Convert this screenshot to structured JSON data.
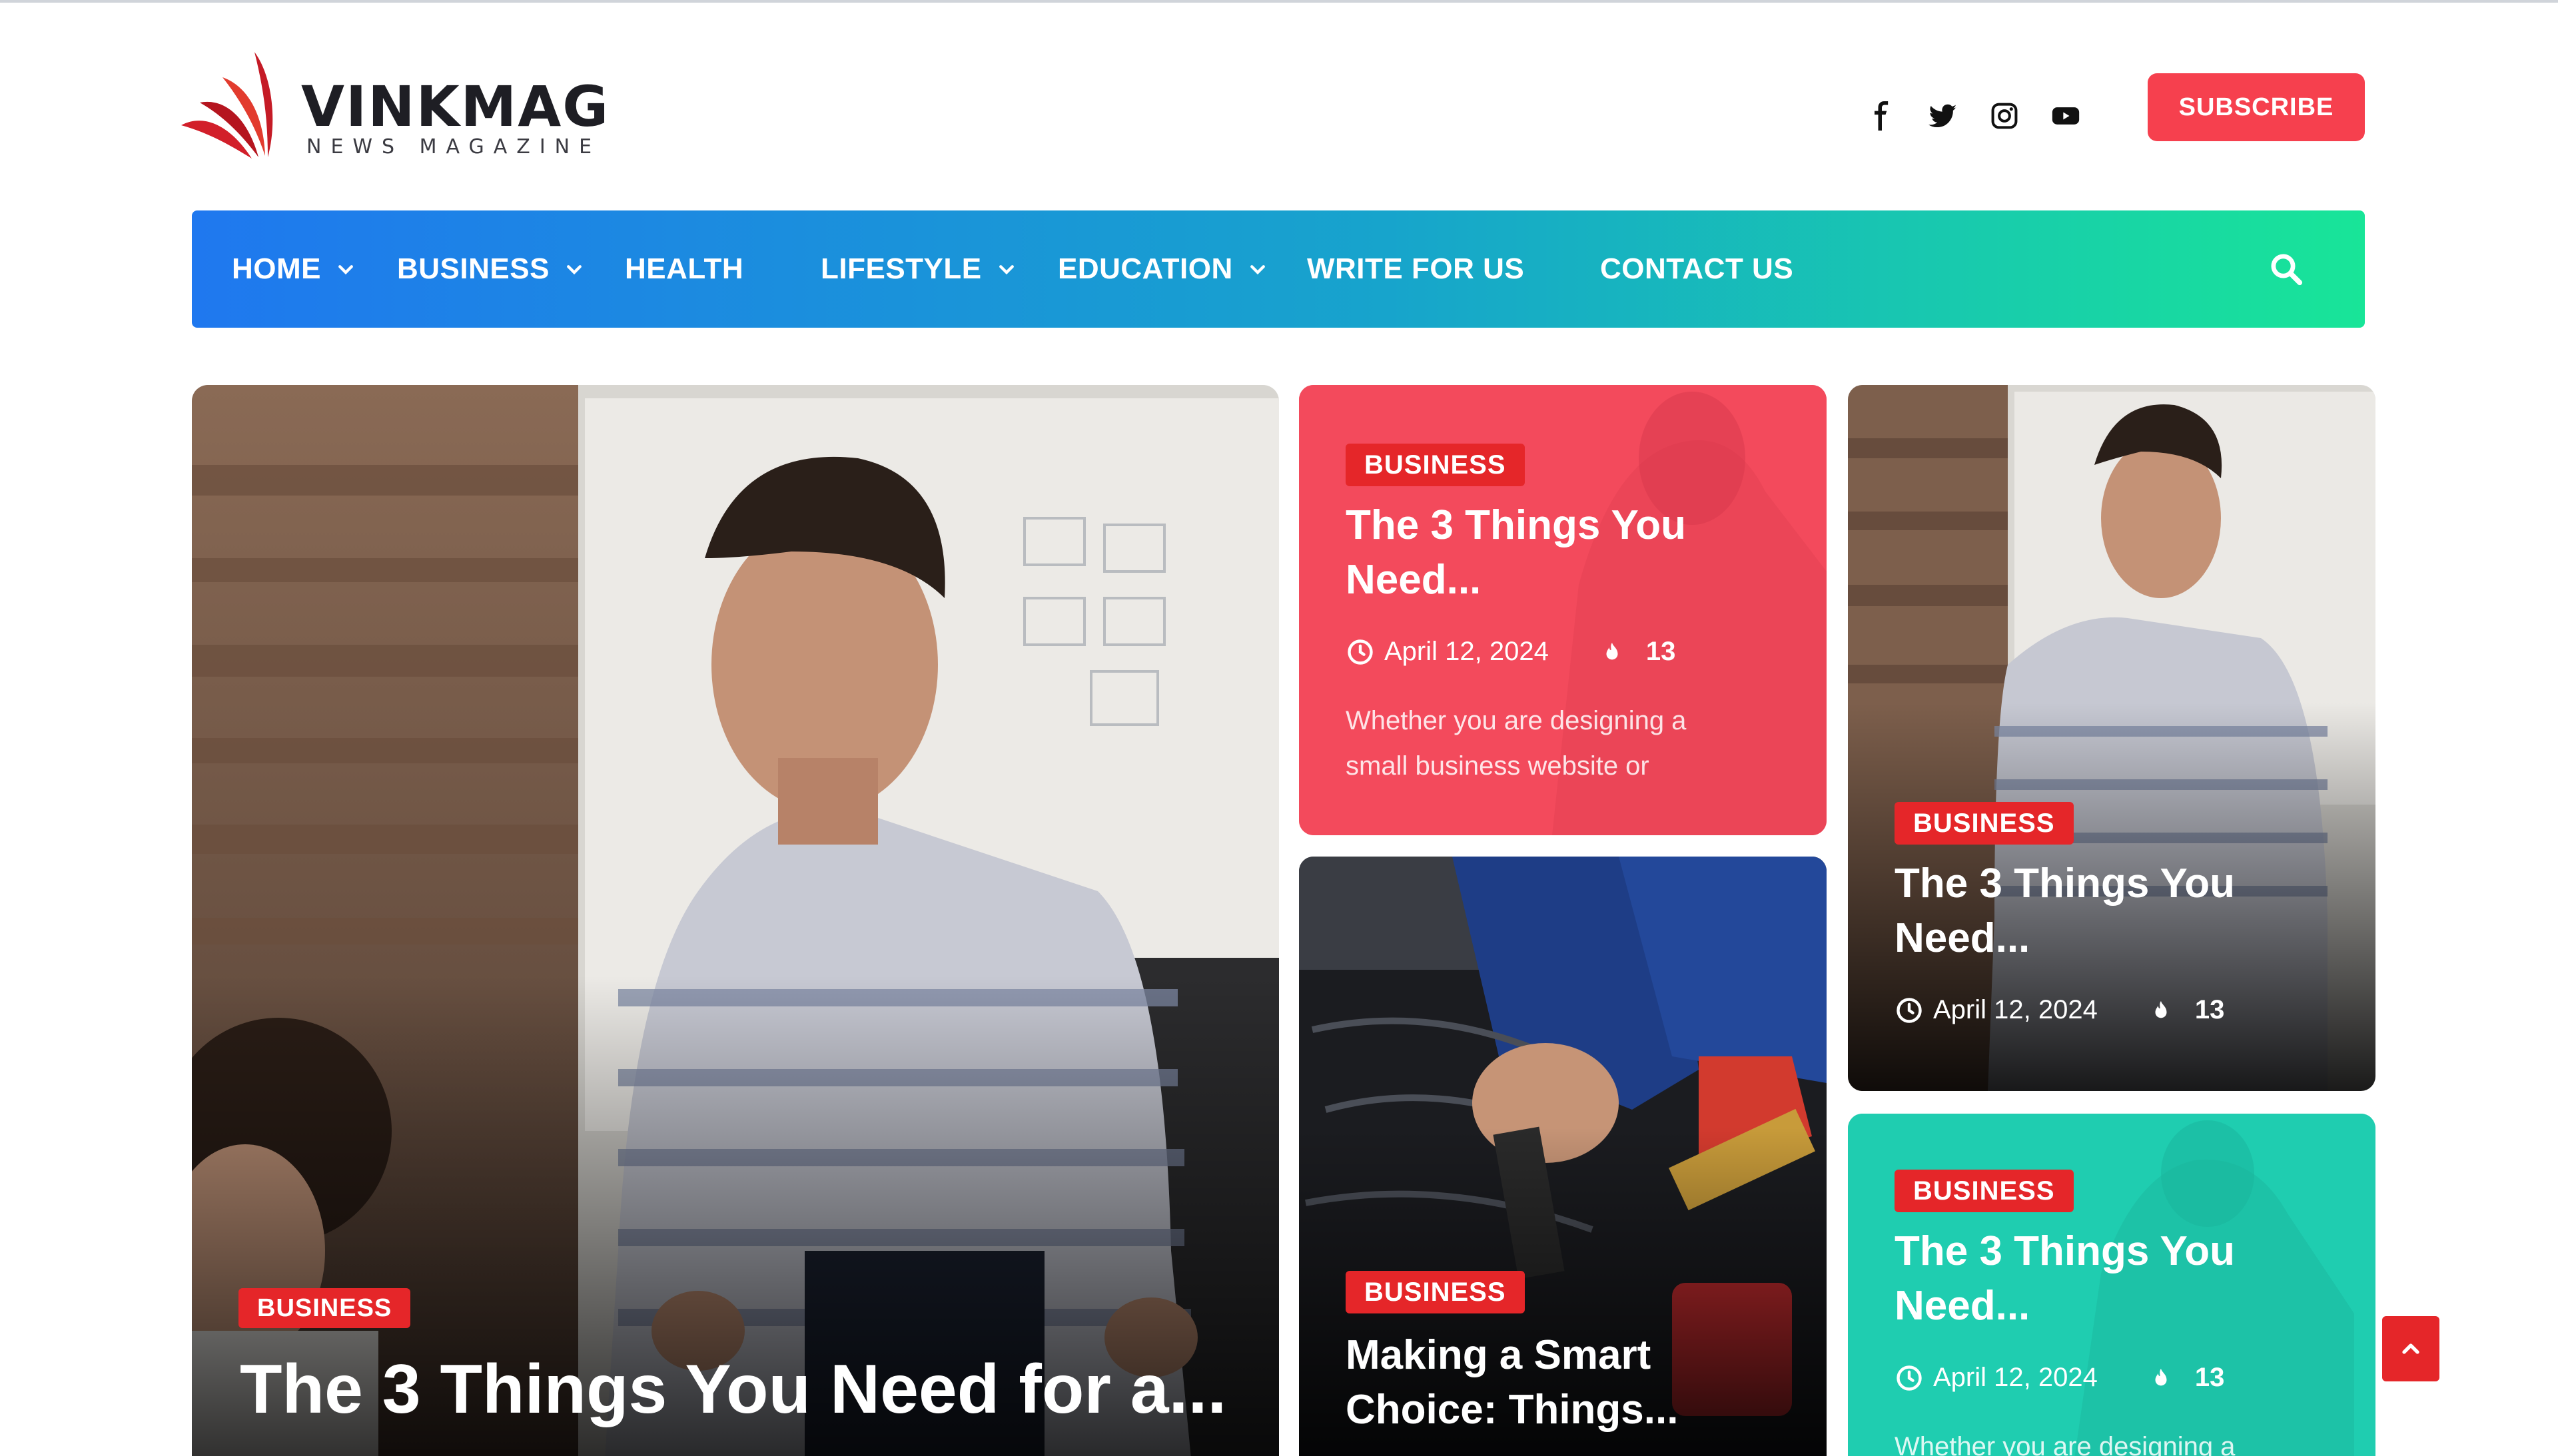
{
  "brand": {
    "name": "VINKMAG",
    "tagline": "NEWS MAGAZINE",
    "accent": "#f6404e"
  },
  "header": {
    "social_icons": [
      "facebook-icon",
      "twitter-icon",
      "instagram-icon",
      "youtube-icon"
    ],
    "subscribe_label": "SUBSCRIBE"
  },
  "nav": {
    "items": [
      {
        "label": "HOME",
        "has_dropdown": true
      },
      {
        "label": "BUSINESS",
        "has_dropdown": true
      },
      {
        "label": "HEALTH",
        "has_dropdown": false
      },
      {
        "label": "LIFESTYLE",
        "has_dropdown": true
      },
      {
        "label": "EDUCATION",
        "has_dropdown": true
      },
      {
        "label": "WRITE FOR US",
        "has_dropdown": false
      },
      {
        "label": "CONTACT US",
        "has_dropdown": false
      }
    ],
    "search_icon": "search-icon",
    "gradient": [
      "#1f78ef",
      "#18e598"
    ]
  },
  "cards": {
    "main": {
      "category": "BUSINESS",
      "title": "The 3 Things You Need for a..."
    },
    "red": {
      "category": "BUSINESS",
      "title": "The 3 Things You Need...",
      "date": "April 12, 2024",
      "views": "13",
      "excerpt": "Whether you are designing a small business website or",
      "color": "#f34a5c"
    },
    "engine": {
      "category": "BUSINESS",
      "title": "Making a Smart Choice: Things..."
    },
    "office": {
      "category": "BUSINESS",
      "title": "The 3 Things You Need...",
      "date": "April 12, 2024",
      "views": "13"
    },
    "teal": {
      "category": "BUSINESS",
      "title": "The 3 Things You Need...",
      "date": "April 12, 2024",
      "views": "13",
      "excerpt": "Whether you are designing a",
      "color": "#1fcdb0"
    }
  },
  "back_to_top_icon": "arrow-up-icon"
}
